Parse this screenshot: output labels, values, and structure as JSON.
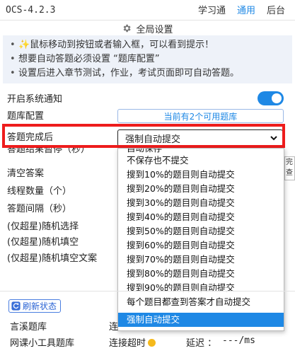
{
  "app": {
    "title": "OCS-4.2.3"
  },
  "tabs": [
    {
      "label": "学习通",
      "active": false
    },
    {
      "label": "通用",
      "active": true
    },
    {
      "label": "后台",
      "active": false
    }
  ],
  "section": {
    "title": "全局设置",
    "icon": "gear-icon"
  },
  "notices": [
    "✨鼠标移动到按钮或者输入框，可以看到提示！",
    "想要自动答题必须设置 “题库配置”",
    "设置后进入章节测试，作业，考试页面即可自动答题。"
  ],
  "settings": {
    "system_notify_label": "开启系统通知",
    "system_notify_on": true,
    "bank_config_label": "题库配置",
    "bank_config_button": "当前有2个可用题库",
    "on_complete_label": "答题完成后",
    "on_complete_value": "强制自动提交",
    "pause_label_partial": "答题结果暂停（秒）",
    "clear_answer_label": "清空答案",
    "threads_label": "线程数量（个）",
    "interval_label": "答题间隔（秒）",
    "random_choice_label": "(仅超星)随机选择",
    "random_fill_label": "(仅超星)随机填空",
    "random_fill_text_label": "(仅超星)随机填空文案"
  },
  "dropdown": {
    "options": [
      "自动保存",
      "不保存也不提交",
      "搜到10%的题目则自动提交",
      "搜到20%的题目则自动提交",
      "搜到30%的题目则自动提交",
      "搜到40%的题目则自动提交",
      "搜到50%的题目则自动提交",
      "搜到60%的题目则自动提交",
      "搜到70%的题目则自动提交",
      "搜到80%的题目则自动提交",
      "搜到90%的题目则自动提交",
      "每个题目都查到答案才自动提交",
      "强制自动提交"
    ],
    "selected": "强制自动提交"
  },
  "side_stub": {
    "text": "完\n查"
  },
  "status": {
    "refresh_label": "刷新状态",
    "banks": [
      {
        "name": "言溪题库",
        "status_partial": "连"
      },
      {
        "name": "网课小工具题库",
        "status": "连接超时",
        "latency_label": "延迟 ：",
        "latency_value": "---/ms"
      }
    ],
    "status_color": "#f5b91c"
  },
  "colors": {
    "accent": "#1e88e5",
    "highlight": "#ee1c1c",
    "notice_bg": "#eef2f9"
  }
}
